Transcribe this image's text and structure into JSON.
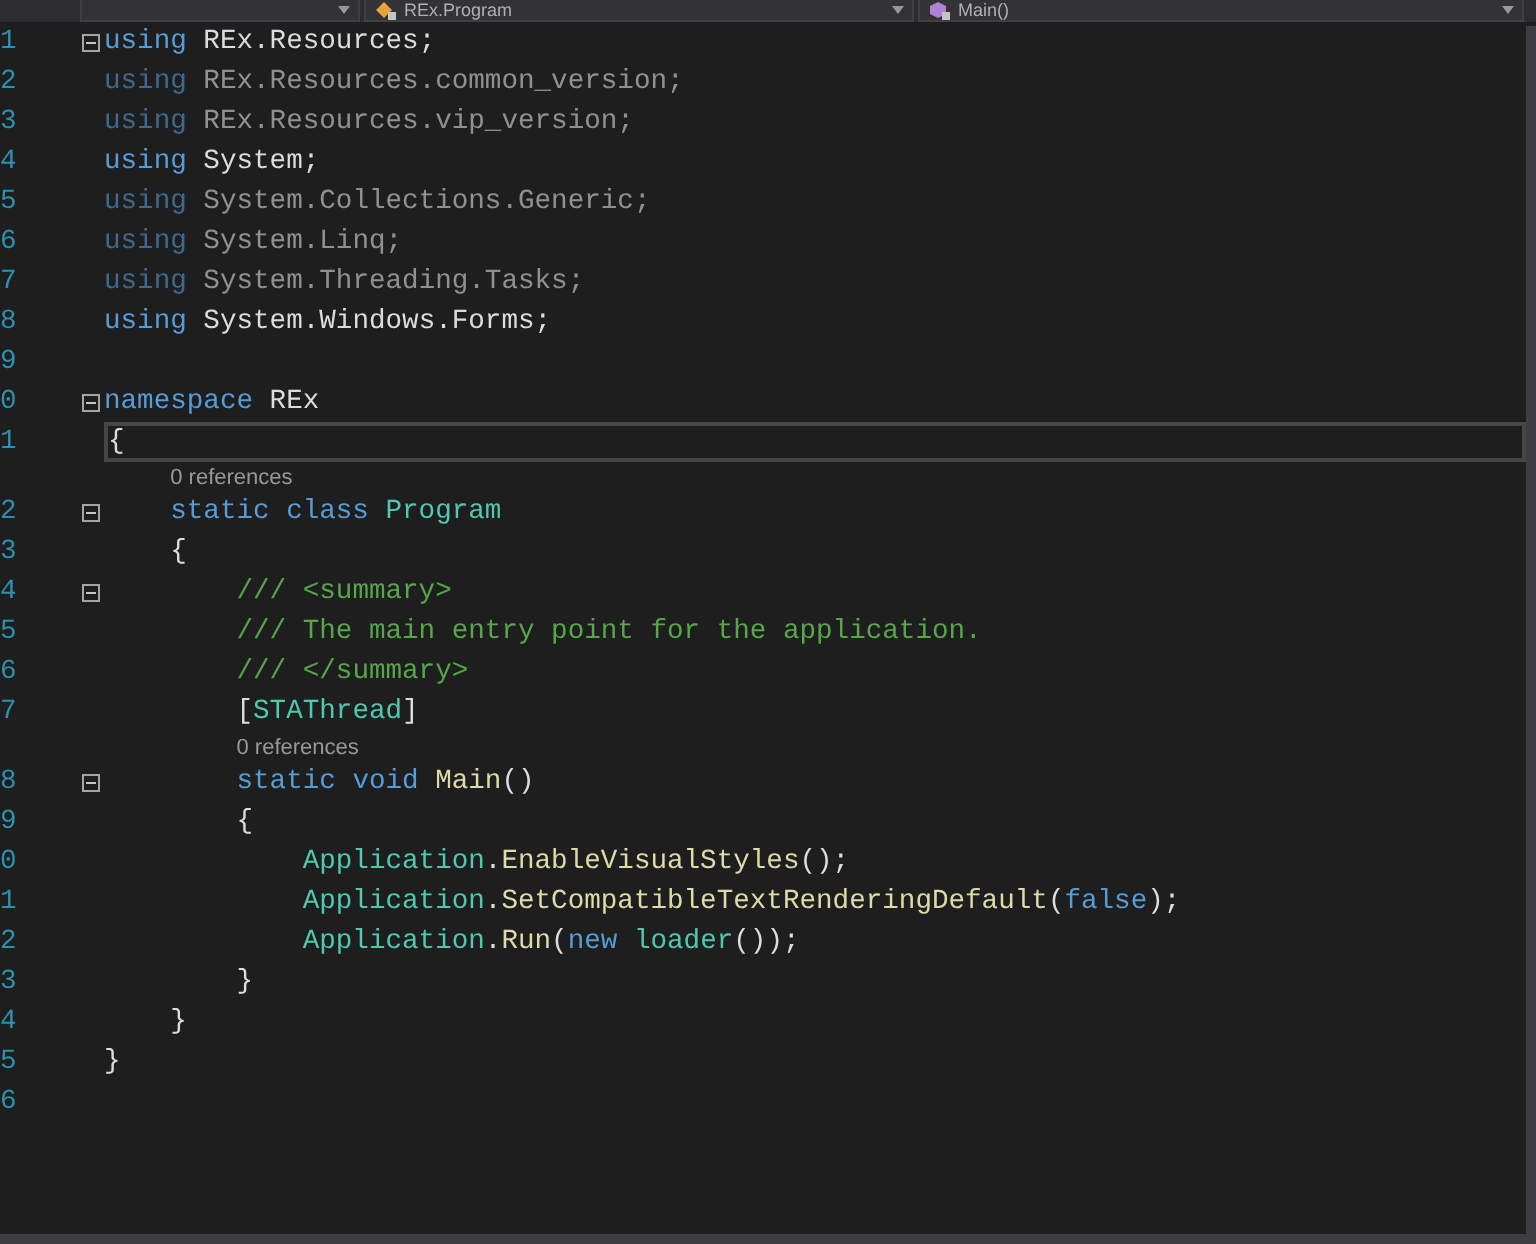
{
  "navigation_bar": {
    "dropdowns": [
      {
        "kind": "empty"
      },
      {
        "kind": "class",
        "label": "REx.Program"
      },
      {
        "kind": "method",
        "label": "Main()"
      }
    ]
  },
  "editor": {
    "lines": [
      {
        "kind": "code",
        "number": "1",
        "fold": true,
        "tokens": [
          {
            "kind": "keyword",
            "text": "using"
          },
          {
            "kind": "plain",
            "text": " REx.Resources;"
          }
        ]
      },
      {
        "kind": "code",
        "number": "2",
        "faded": true,
        "tokens": [
          {
            "kind": "keyword",
            "text": "using"
          },
          {
            "kind": "plain",
            "text": " REx.Resources.common_version;"
          }
        ]
      },
      {
        "kind": "code",
        "number": "3",
        "faded": true,
        "tokens": [
          {
            "kind": "keyword",
            "text": "using"
          },
          {
            "kind": "plain",
            "text": " REx.Resources.vip_version;"
          }
        ]
      },
      {
        "kind": "code",
        "number": "4",
        "faded": false,
        "tokens": [
          {
            "kind": "keyword",
            "text": "using"
          },
          {
            "kind": "plain",
            "text": " System;"
          }
        ]
      },
      {
        "kind": "code",
        "number": "5",
        "faded": true,
        "tokens": [
          {
            "kind": "keyword",
            "text": "using"
          },
          {
            "kind": "plain",
            "text": " System.Collections.Generic;"
          }
        ]
      },
      {
        "kind": "code",
        "number": "6",
        "faded": true,
        "tokens": [
          {
            "kind": "keyword",
            "text": "using"
          },
          {
            "kind": "plain",
            "text": " System.Linq;"
          }
        ]
      },
      {
        "kind": "code",
        "number": "7",
        "faded": true,
        "tokens": [
          {
            "kind": "keyword",
            "text": "using"
          },
          {
            "kind": "plain",
            "text": " System.Threading.Tasks;"
          }
        ]
      },
      {
        "kind": "code",
        "number": "8",
        "faded": false,
        "tokens": [
          {
            "kind": "keyword",
            "text": "using"
          },
          {
            "kind": "plain",
            "text": " System.Windows.Forms;"
          }
        ]
      },
      {
        "kind": "code",
        "number": "9"
      },
      {
        "kind": "code",
        "number": "0",
        "fold": true,
        "tokens": [
          {
            "kind": "keyword",
            "text": "namespace"
          },
          {
            "kind": "plain",
            "text": " REx"
          }
        ]
      },
      {
        "kind": "code",
        "number": "1",
        "current": true,
        "tokens": [
          {
            "kind": "plain",
            "text": "{"
          }
        ],
        "children": [
          {
            "kind": "lens",
            "text": "0 references"
          },
          {
            "kind": "code",
            "number": "2",
            "fold": true,
            "tokens": [
              {
                "kind": "keyword",
                "text": "static class"
              },
              {
                "kind": "type",
                "text": " Program"
              }
            ]
          },
          {
            "kind": "code",
            "number": "3",
            "tokens": [
              {
                "kind": "plain",
                "text": "{"
              }
            ],
            "children": [
              {
                "kind": "code",
                "number": "4",
                "fold": true,
                "tokens": [
                  {
                    "kind": "comment",
                    "text": "/// <summary>"
                  }
                ]
              },
              {
                "kind": "code",
                "number": "5",
                "tokens": [
                  {
                    "kind": "comment",
                    "text": "/// The main entry point for the application."
                  }
                ]
              },
              {
                "kind": "code",
                "number": "6",
                "tokens": [
                  {
                    "kind": "comment",
                    "text": "/// </summary>"
                  }
                ]
              },
              {
                "kind": "code",
                "number": "7",
                "tokens": [
                  {
                    "kind": "plain",
                    "text": "["
                  },
                  {
                    "kind": "type",
                    "text": "STAThread"
                  },
                  {
                    "kind": "plain",
                    "text": "]"
                  }
                ]
              },
              {
                "kind": "lens",
                "text": "0 references"
              },
              {
                "kind": "code",
                "number": "8",
                "fold": true,
                "tokens": [
                  {
                    "kind": "keyword",
                    "text": "static void"
                  },
                  {
                    "kind": "method",
                    "text": " Main"
                  },
                  {
                    "kind": "plain",
                    "text": "()"
                  }
                ]
              },
              {
                "kind": "code",
                "number": "9",
                "tokens": [
                  {
                    "kind": "plain",
                    "text": "{"
                  }
                ],
                "children": [
                  {
                    "kind": "code",
                    "number": "0",
                    "tokens": [
                      {
                        "kind": "type",
                        "text": "Application"
                      },
                      {
                        "kind": "plain",
                        "text": "."
                      },
                      {
                        "kind": "method",
                        "text": "EnableVisualStyles"
                      },
                      {
                        "kind": "plain",
                        "text": "();"
                      }
                    ]
                  },
                  {
                    "kind": "code",
                    "number": "1",
                    "tokens": [
                      {
                        "kind": "type",
                        "text": "Application"
                      },
                      {
                        "kind": "plain",
                        "text": "."
                      },
                      {
                        "kind": "method",
                        "text": "SetCompatibleTextRenderingDefault"
                      },
                      {
                        "kind": "plain",
                        "text": "("
                      },
                      {
                        "kind": "keyword",
                        "text": "false"
                      },
                      {
                        "kind": "plain",
                        "text": ");"
                      }
                    ]
                  },
                  {
                    "kind": "code",
                    "number": "2",
                    "tokens": [
                      {
                        "kind": "type",
                        "text": "Application"
                      },
                      {
                        "kind": "plain",
                        "text": "."
                      },
                      {
                        "kind": "method",
                        "text": "Run"
                      },
                      {
                        "kind": "plain",
                        "text": "("
                      },
                      {
                        "kind": "keyword",
                        "text": "new"
                      },
                      {
                        "kind": "type",
                        "text": " loader"
                      },
                      {
                        "kind": "plain",
                        "text": "());"
                      }
                    ]
                  }
                ]
              },
              {
                "kind": "code",
                "number": "3",
                "tokens": [
                  {
                    "kind": "plain",
                    "text": "}"
                  }
                ]
              }
            ]
          },
          {
            "kind": "code",
            "number": "4",
            "tokens": [
              {
                "kind": "plain",
                "text": "}"
              }
            ]
          }
        ]
      },
      {
        "kind": "code",
        "number": "5",
        "tokens": [
          {
            "kind": "plain",
            "text": "}"
          }
        ]
      },
      {
        "kind": "code",
        "number": "6"
      }
    ]
  }
}
